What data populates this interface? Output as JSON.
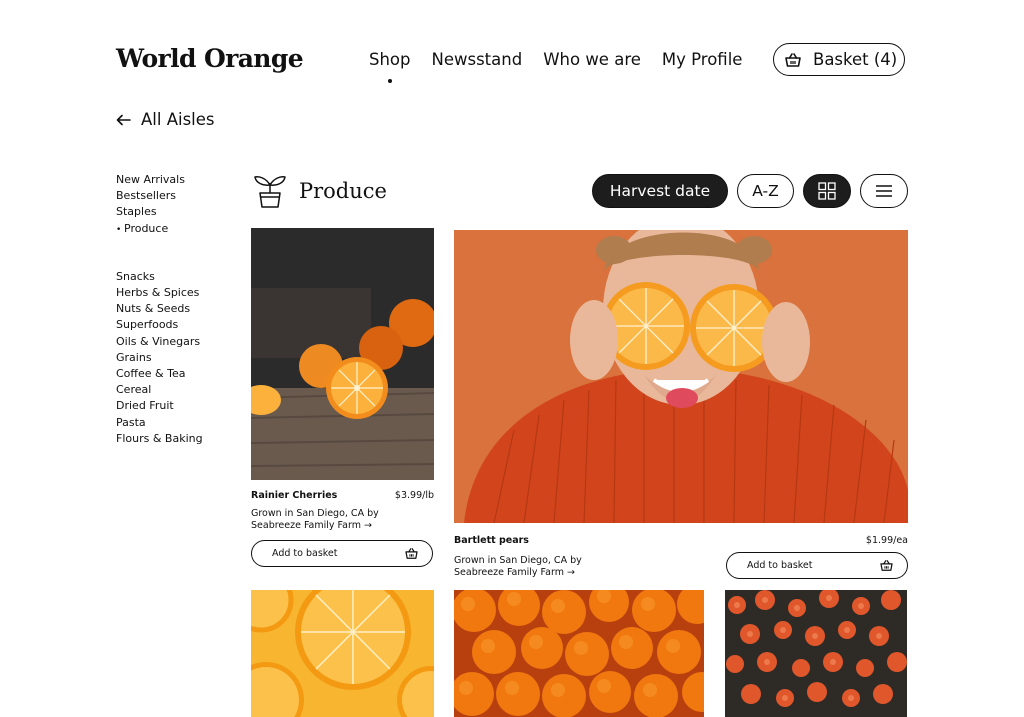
{
  "brand": {
    "logo": "World Orange"
  },
  "nav": {
    "items": [
      {
        "label": "Shop",
        "active": true
      },
      {
        "label": "Newsstand"
      },
      {
        "label": "Who we are"
      },
      {
        "label": "My Profile"
      }
    ],
    "basket_label": "Basket (4)",
    "basket_icon": "basket-icon"
  },
  "back": {
    "label": "All Aisles",
    "icon": "arrow-left-icon"
  },
  "sidebar": {
    "group1": [
      "New Arrivals",
      "Bestsellers",
      "Staples"
    ],
    "active": "Produce",
    "group2": [
      "Snacks",
      "Herbs & Spices",
      "Nuts & Seeds",
      "Superfoods",
      "Oils & Vinegars",
      "Grains",
      "Coffee & Tea",
      "Cereal",
      "Dried Fruit",
      "Pasta",
      "Flours & Baking"
    ]
  },
  "category": {
    "title": "Produce",
    "icon": "plant-pot-icon"
  },
  "controls": {
    "sort_label": "Harvest date",
    "az_label": "A-Z",
    "grid_icon": "grid-view-icon",
    "list_icon": "list-view-icon"
  },
  "products": [
    {
      "name": "Rainier Cherries",
      "price": "$3.99/lb",
      "origin": "Grown in San Diego,  CA by",
      "farm": "Seabreeze Family Farm →",
      "button": "Add to basket"
    },
    {
      "name": "Bartlett pears",
      "price": "$1.99/ea",
      "origin": "Grown in San Diego,  CA by",
      "farm": "Seabreeze Family Farm →",
      "button": "Add to basket"
    }
  ],
  "colors": {
    "text": "#111111",
    "dark_pill": "#1d1d1d",
    "accent_orange": "#d9743f"
  }
}
